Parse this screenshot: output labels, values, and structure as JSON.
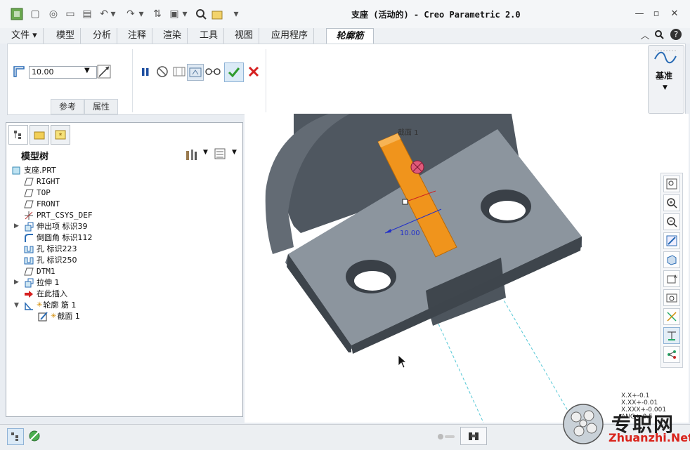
{
  "window": {
    "title": "支座 (活动的) - Creo Parametric 2.0"
  },
  "menu": {
    "items": [
      "文件",
      "模型",
      "分析",
      "注释",
      "渲染",
      "工具",
      "视图",
      "应用程序"
    ],
    "active_tab": "轮廓筋"
  },
  "ribbon": {
    "thickness_value": "10.00",
    "subtabs": [
      "参考",
      "属性"
    ],
    "datum_label": "基准"
  },
  "model_tree": {
    "title": "模型树",
    "nodes": [
      {
        "label": "支座.PRT",
        "icon": "part-icon"
      },
      {
        "label": "RIGHT",
        "icon": "datum-plane-icon"
      },
      {
        "label": "TOP",
        "icon": "datum-plane-icon"
      },
      {
        "label": "FRONT",
        "icon": "datum-plane-icon"
      },
      {
        "label": "PRT_CSYS_DEF",
        "icon": "csys-icon"
      },
      {
        "label": "伸出项 标识39",
        "icon": "protrusion-icon"
      },
      {
        "label": "倒圆角 标识112",
        "icon": "round-icon"
      },
      {
        "label": "孔 标识223",
        "icon": "hole-icon"
      },
      {
        "label": "孔 标识250",
        "icon": "hole-icon"
      },
      {
        "label": "DTM1",
        "icon": "datum-plane-icon"
      },
      {
        "label": "拉伸 1",
        "icon": "extrude-icon"
      },
      {
        "label": "在此插入",
        "icon": "insert-arrow-icon"
      },
      {
        "label": "轮廓 筋 1",
        "icon": "rib-icon"
      },
      {
        "label": "截面 1",
        "icon": "sketch-icon"
      }
    ]
  },
  "viewport": {
    "section_label": "截面 1",
    "dimension": "10.00",
    "tolerances": [
      "X.X+-0.1",
      "X.XX+-0.01",
      "X.XXX+-0.001",
      "ANG+-0.5"
    ]
  },
  "watermark": {
    "text": "专职网",
    "url": "Zhuanzhi.Net"
  },
  "colors": {
    "rib": "#f0941c",
    "part": "#8c959e",
    "accent": "#2a7ccc"
  }
}
